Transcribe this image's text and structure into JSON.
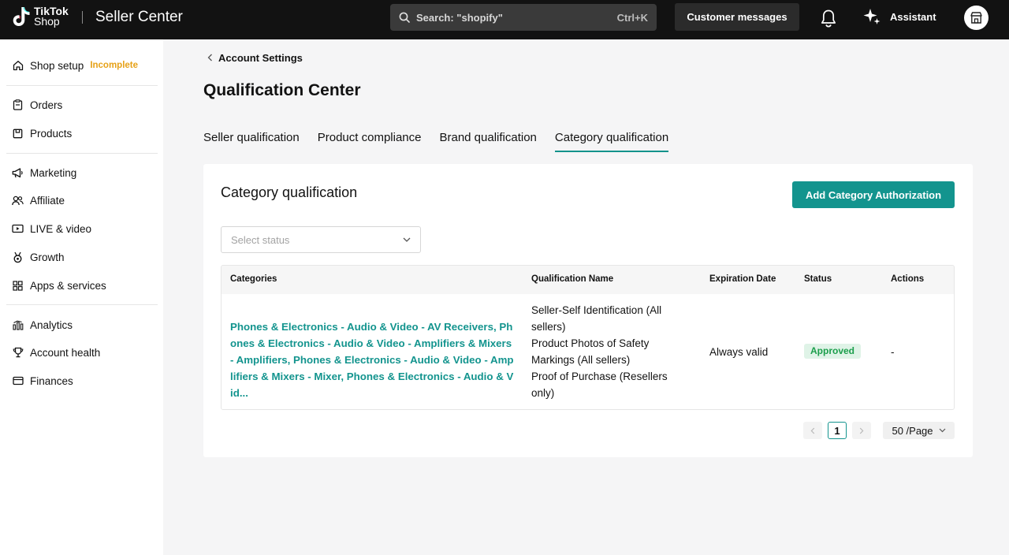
{
  "header": {
    "logo_line1": "TikTok",
    "logo_line2": "Shop",
    "product_name": "Seller Center",
    "search_placeholder": "Search: \"shopify\"",
    "search_shortcut": "Ctrl+K",
    "customer_messages": "Customer messages",
    "assistant": "Assistant"
  },
  "sidebar": {
    "shop_setup": "Shop setup",
    "shop_setup_status": "Incomplete",
    "items": [
      {
        "label": "Orders"
      },
      {
        "label": "Products"
      },
      {
        "label": "Marketing"
      },
      {
        "label": "Affiliate"
      },
      {
        "label": "LIVE & video"
      },
      {
        "label": "Growth"
      },
      {
        "label": "Apps & services"
      },
      {
        "label": "Analytics"
      },
      {
        "label": "Account health"
      },
      {
        "label": "Finances"
      }
    ]
  },
  "main": {
    "breadcrumb": "Account Settings",
    "page_title": "Qualification Center",
    "tabs": [
      {
        "label": "Seller qualification"
      },
      {
        "label": "Product compliance"
      },
      {
        "label": "Brand qualification"
      },
      {
        "label": "Category qualification",
        "active": true
      }
    ],
    "card_title": "Category qualification",
    "add_button": "Add Category Authorization",
    "status_placeholder": "Select status",
    "table": {
      "columns": [
        "Categories",
        "Qualification Name",
        "Expiration Date",
        "Status",
        "Actions"
      ],
      "rows": [
        {
          "categories": "Phones & Electronics - Audio & Video - AV Receivers, Phones & Electronics - Audio & Video - Amplifiers & Mixers - Amplifiers, Phones & Electronics - Audio & Video - Amplifiers & Mixers - Mixer, Phones & Electronics - Audio & Vid...",
          "qualification_lines": [
            "Seller-Self Identification (All",
            "sellers)",
            "Product Photos of Safety",
            "Markings (All sellers)",
            "Proof of Purchase (Resellers",
            "only)"
          ],
          "expiration": "Always valid",
          "status": "Approved",
          "actions": "-"
        }
      ]
    },
    "pagination": {
      "current_page": "1",
      "per_page": "50 /Page"
    }
  },
  "colors": {
    "accent": "#13948e",
    "approved_bg": "#dff3e7",
    "approved_text": "#1b9e4b",
    "incomplete": "#e6a117"
  }
}
